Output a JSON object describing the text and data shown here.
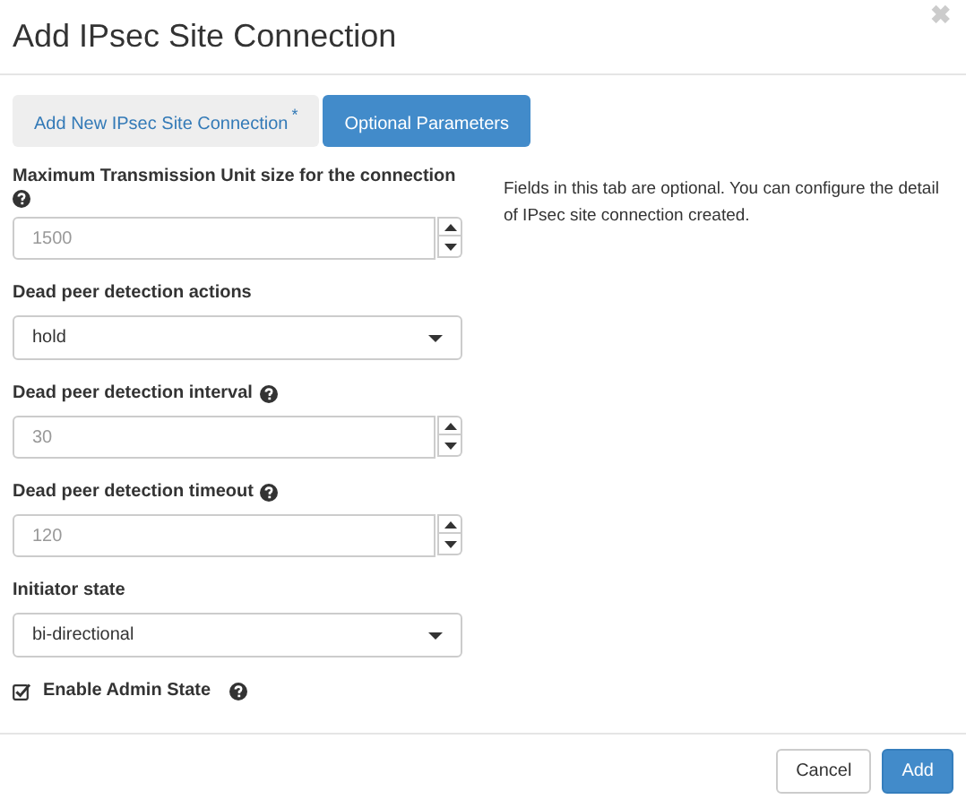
{
  "dialog": {
    "title": "Add IPsec Site Connection",
    "close": "✖"
  },
  "tabs": [
    {
      "label": "Add New IPsec Site Connection",
      "required_mark": "*",
      "selected": false
    },
    {
      "label": "Optional Parameters",
      "selected": true
    }
  ],
  "fields": [
    {
      "kind": "number",
      "label": "Maximum Transmission Unit size for the connection",
      "help": true,
      "placeholder": "1500"
    },
    {
      "kind": "select",
      "label": "Dead peer detection actions",
      "help": false,
      "value": "hold"
    },
    {
      "kind": "number",
      "label": "Dead peer detection interval",
      "help": true,
      "placeholder": "30"
    },
    {
      "kind": "number",
      "label": "Dead peer detection timeout",
      "help": true,
      "placeholder": "120"
    },
    {
      "kind": "select",
      "label": "Initiator state",
      "help": false,
      "value": "bi-directional"
    },
    {
      "kind": "checkbox",
      "label": "Enable Admin State",
      "help": true,
      "checked": true
    }
  ],
  "description": "Fields in this tab are optional. You can configure the detail of IPsec site connection created.",
  "buttons": [
    {
      "label": "Cancel",
      "kind": "default"
    },
    {
      "label": "Add",
      "kind": "primary"
    }
  ]
}
